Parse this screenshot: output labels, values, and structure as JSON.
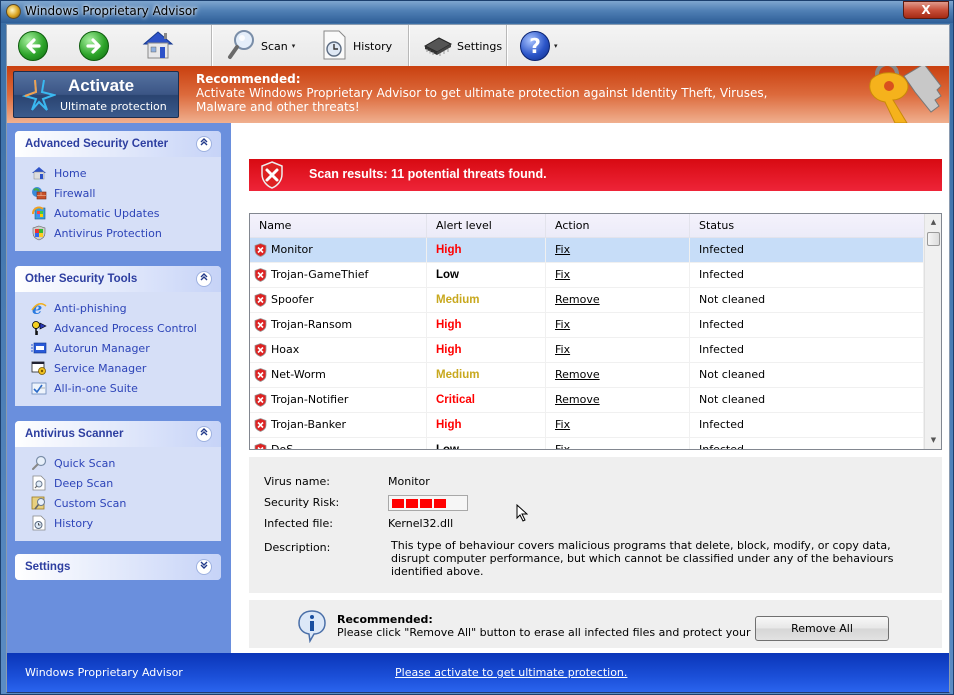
{
  "window": {
    "title": "Windows Proprietary Advisor",
    "close_label": "X"
  },
  "toolbar": {
    "back_icon": "arrow-left-icon",
    "forward_icon": "arrow-right-icon",
    "home_icon": "house-icon",
    "scan_label": "Scan",
    "history_label": "History",
    "settings_label": "Settings",
    "help_glyph": "?",
    "caret": "▾"
  },
  "banner": {
    "activate_title": "Activate",
    "activate_sub": "Ultimate protection",
    "rec_title": "Recommended:",
    "rec_text": "Activate Windows Proprietary Advisor to get ultimate protection against Identity Theft, Viruses, Malware and other threats!"
  },
  "sidebar": {
    "panels": [
      {
        "title": "Advanced Security Center",
        "toggle": "expanded",
        "items": [
          {
            "label": "Home",
            "icon": "house-icon"
          },
          {
            "label": "Firewall",
            "icon": "firewall-icon"
          },
          {
            "label": "Automatic Updates",
            "icon": "updates-icon"
          },
          {
            "label": "Antivirus Protection",
            "icon": "shield-icon"
          }
        ]
      },
      {
        "title": "Other Security Tools",
        "toggle": "expanded",
        "items": [
          {
            "label": "Anti-phishing",
            "icon": "ie-icon"
          },
          {
            "label": "Advanced Process Control",
            "icon": "keys-icon"
          },
          {
            "label": "Autorun Manager",
            "icon": "window-icon"
          },
          {
            "label": "Service Manager",
            "icon": "service-icon"
          },
          {
            "label": "All-in-one Suite",
            "icon": "checklist-icon"
          }
        ]
      },
      {
        "title": "Antivirus Scanner",
        "toggle": "expanded",
        "items": [
          {
            "label": "Quick Scan",
            "icon": "magnifier-icon"
          },
          {
            "label": "Deep Scan",
            "icon": "document-search-icon"
          },
          {
            "label": "Custom Scan",
            "icon": "folder-search-icon"
          },
          {
            "label": "History",
            "icon": "clock-document-icon"
          }
        ]
      },
      {
        "title": "Settings",
        "toggle": "collapsed",
        "items": []
      }
    ],
    "expand_glyph": "«",
    "collapse_glyph": "»"
  },
  "alert": {
    "text": "Scan results: 11 potential threats found."
  },
  "grid": {
    "columns": [
      "Name",
      "Alert level",
      "Action",
      "Status"
    ],
    "rows": [
      {
        "name": "Monitor",
        "level": "High",
        "action": "Fix",
        "status": "Infected",
        "selected": true
      },
      {
        "name": "Trojan-GameThief",
        "level": "Low",
        "action": "Fix",
        "status": "Infected"
      },
      {
        "name": "Spoofer",
        "level": "Medium",
        "action": "Remove",
        "status": "Not cleaned"
      },
      {
        "name": "Trojan-Ransom",
        "level": "High",
        "action": "Fix",
        "status": "Infected"
      },
      {
        "name": "Hoax",
        "level": "High",
        "action": "Fix",
        "status": "Infected"
      },
      {
        "name": "Net-Worm",
        "level": "Medium",
        "action": "Remove",
        "status": "Not cleaned"
      },
      {
        "name": "Trojan-Notifier",
        "level": "Critical",
        "action": "Remove",
        "status": "Not cleaned"
      },
      {
        "name": "Trojan-Banker",
        "level": "High",
        "action": "Fix",
        "status": "Infected"
      },
      {
        "name": "DoS",
        "level": "Low",
        "action": "Fix",
        "status": "Infected"
      }
    ],
    "level_colors": {
      "High": "#ff0000",
      "Critical": "#ff0000",
      "Medium": "#c8a81e",
      "Low": "#000000"
    },
    "scroll_up": "▲",
    "scroll_down": "▼"
  },
  "details": {
    "virus_name_label": "Virus name:",
    "virus_name": "Monitor",
    "risk_label": "Security Risk:",
    "risk_level": 4,
    "risk_max": 5,
    "file_label": "Infected file:",
    "file": "Kernel32.dll",
    "desc_label": "Description:",
    "desc": "This type of behaviour covers malicious programs that delete, block, modify, or copy data, disrupt computer performance, but which cannot be classified under any of the behaviours identified above."
  },
  "recommend": {
    "title": "Recommended:",
    "text": "Please click \"Remove All\" button to erase all infected files and protect your PC",
    "button": "Remove All"
  },
  "footer": {
    "app_name": "Windows Proprietary Advisor",
    "link": "Please activate to get ultimate protection."
  }
}
